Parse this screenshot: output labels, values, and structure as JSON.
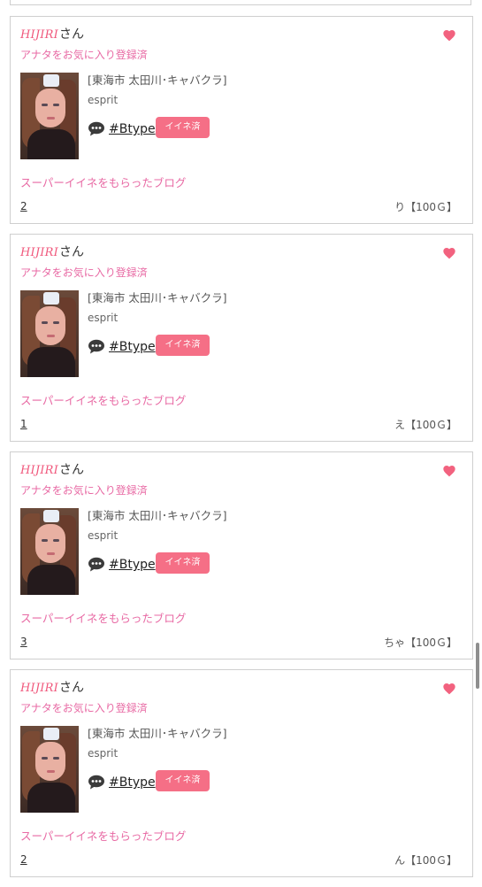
{
  "cards": [
    {
      "cast_name": "HIJIRI",
      "honorific": "さん",
      "favorite_status": "アナタをお気に入り登録済",
      "shop_area": "[東海市 太田川･キャバクラ]",
      "shop_name": "esprit",
      "tag": "#Btype",
      "iine_label": "イイネ済",
      "blog_heading": "スーパーイイネをもらったブログ",
      "blog_count": "2",
      "blog_meta": "り【100Ｇ】"
    },
    {
      "cast_name": "HIJIRI",
      "honorific": "さん",
      "favorite_status": "アナタをお気に入り登録済",
      "shop_area": "[東海市 太田川･キャバクラ]",
      "shop_name": "esprit",
      "tag": "#Btype",
      "iine_label": "イイネ済",
      "blog_heading": "スーパーイイネをもらったブログ",
      "blog_count": "1",
      "blog_meta": "え【100Ｇ】"
    },
    {
      "cast_name": "HIJIRI",
      "honorific": "さん",
      "favorite_status": "アナタをお気に入り登録済",
      "shop_area": "[東海市 太田川･キャバクラ]",
      "shop_name": "esprit",
      "tag": "#Btype",
      "iine_label": "イイネ済",
      "blog_heading": "スーパーイイネをもらったブログ",
      "blog_count": "3",
      "blog_meta": "ちゃ【100Ｇ】"
    },
    {
      "cast_name": "HIJIRI",
      "honorific": "さん",
      "favorite_status": "アナタをお気に入り登録済",
      "shop_area": "[東海市 太田川･キャバクラ]",
      "shop_name": "esprit",
      "tag": "#Btype",
      "iine_label": "イイネ済",
      "blog_heading": "スーパーイイネをもらったブログ",
      "blog_count": "2",
      "blog_meta": "ん【100Ｇ】"
    }
  ],
  "icons": {
    "favorite": "heart-icon",
    "tag": "comment-bubble-icon"
  },
  "colors": {
    "accent_pink": "#e86aa4",
    "name_pink": "#f0587c",
    "badge": "#f56f86",
    "heart": "#f2627f"
  }
}
